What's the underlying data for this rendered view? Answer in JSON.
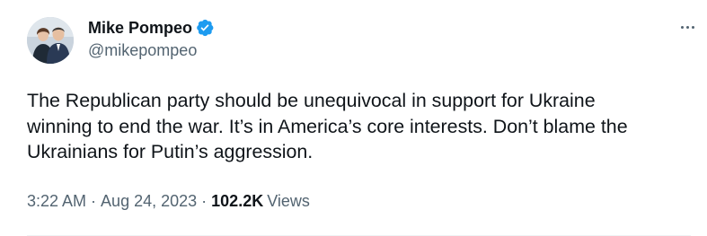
{
  "author": {
    "display_name": "Mike Pompeo",
    "handle": "@mikepompeo",
    "verified": true
  },
  "tweet": {
    "text": "The Republican party should be unequivocal in support for Ukraine\nwinning to end the war. It’s in America’s core interests. Don’t blame the\nUkrainians for Putin’s aggression.",
    "time": "3:22 AM",
    "separator": "·",
    "date": "Aug 24, 2023",
    "views_count": "102.2K",
    "views_label": "Views"
  },
  "icons": {
    "verified": "verified-badge-icon",
    "more": "more-options-icon"
  },
  "colors": {
    "verified_blue": "#1d9bf0",
    "text_primary": "#0f1419",
    "text_secondary": "#536471"
  }
}
